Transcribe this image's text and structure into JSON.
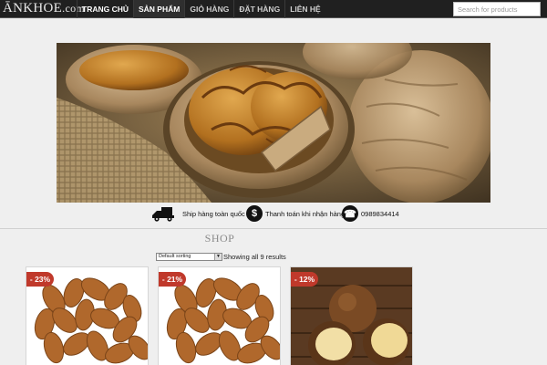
{
  "header": {
    "logo": {
      "main": "ĀNKHOE",
      "suffix": ".com"
    },
    "nav": [
      {
        "label": "TRANG CHỦ"
      },
      {
        "label": "SẢN PHẨM"
      },
      {
        "label": "GIỎ HÀNG"
      },
      {
        "label": "ĐẶT HÀNG"
      },
      {
        "label": "LIÊN HỆ"
      }
    ],
    "search": {
      "placeholder": "Search for products",
      "value": ""
    }
  },
  "info_bar": [
    {
      "icon": "delivery-truck-icon",
      "text": "Ship hàng toàn quốc"
    },
    {
      "icon": "dollar-icon",
      "glyph": "$",
      "text": "Thanh toán khi nhận hàng"
    },
    {
      "icon": "phone-icon",
      "glyph": "☎",
      "text": "0989834414"
    }
  ],
  "shop": {
    "title": "SHOP",
    "sort_value": "Default sorting",
    "result_count": "Showing all 9 results"
  },
  "products": [
    {
      "badge": "- 23%",
      "image": "almonds"
    },
    {
      "badge": "- 21%",
      "image": "almonds"
    },
    {
      "badge": "- 12%",
      "image": "macadamia"
    }
  ],
  "colors": {
    "nav_bg": "#202020",
    "badge": "#c0392b",
    "page_bg": "#efefef"
  }
}
